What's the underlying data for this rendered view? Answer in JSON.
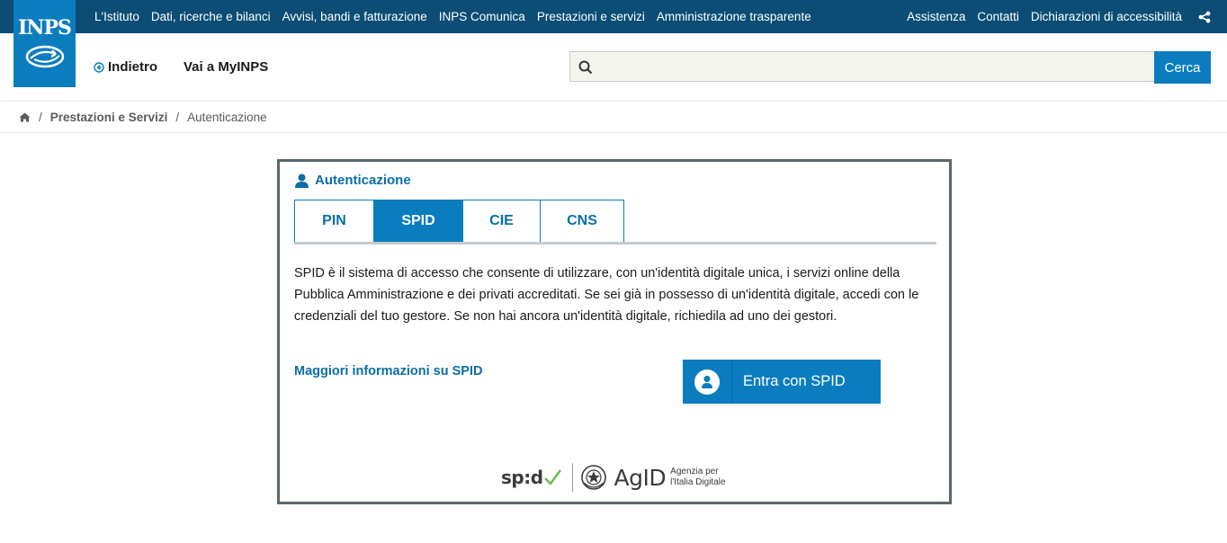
{
  "logo": {
    "text": "INPS"
  },
  "topnav": {
    "items": [
      "L'Istituto",
      "Dati, ricerche e bilanci",
      "Avvisi, bandi e fatturazione",
      "INPS Comunica",
      "Prestazioni e servizi",
      "Amministrazione trasparente"
    ],
    "right": [
      "Assistenza",
      "Contatti",
      "Dichiarazioni di accessibilità"
    ]
  },
  "header": {
    "back_label": "Indietro",
    "myinps_label": "Vai a MyINPS"
  },
  "search": {
    "value": "",
    "placeholder": "",
    "button_label": "Cerca"
  },
  "breadcrumb": {
    "items": [
      "Prestazioni e Servizi",
      "Autenticazione"
    ],
    "separator": "/"
  },
  "auth": {
    "title": "Autenticazione",
    "tabs": [
      {
        "label": "PIN",
        "active": false
      },
      {
        "label": "SPID",
        "active": true
      },
      {
        "label": "CIE",
        "active": false
      },
      {
        "label": "CNS",
        "active": false
      }
    ],
    "description": "SPID è il sistema di accesso che consente di utilizzare, con un'identità digitale unica, i servizi online della Pubblica Amministrazione e dei privati accreditati. Se sei già in possesso di un'identità digitale, accedi con le credenziali del tuo gestore. Se non hai ancora un'identità digitale, richiedila ad uno dei gestori.",
    "more_link": "Maggiori informazioni su SPID",
    "spid_button": "Entra con SPID",
    "spid_logo_text": "sp:d",
    "agid_name": "AgID",
    "agid_sub_1": "Agenzia per",
    "agid_sub_2": "l'Italia Digitale"
  },
  "colors": {
    "topbar": "#0b4d75",
    "brand_blue": "#0b7dbf",
    "link_blue": "#0b6ea8",
    "spid_check": "#6cbd45"
  }
}
